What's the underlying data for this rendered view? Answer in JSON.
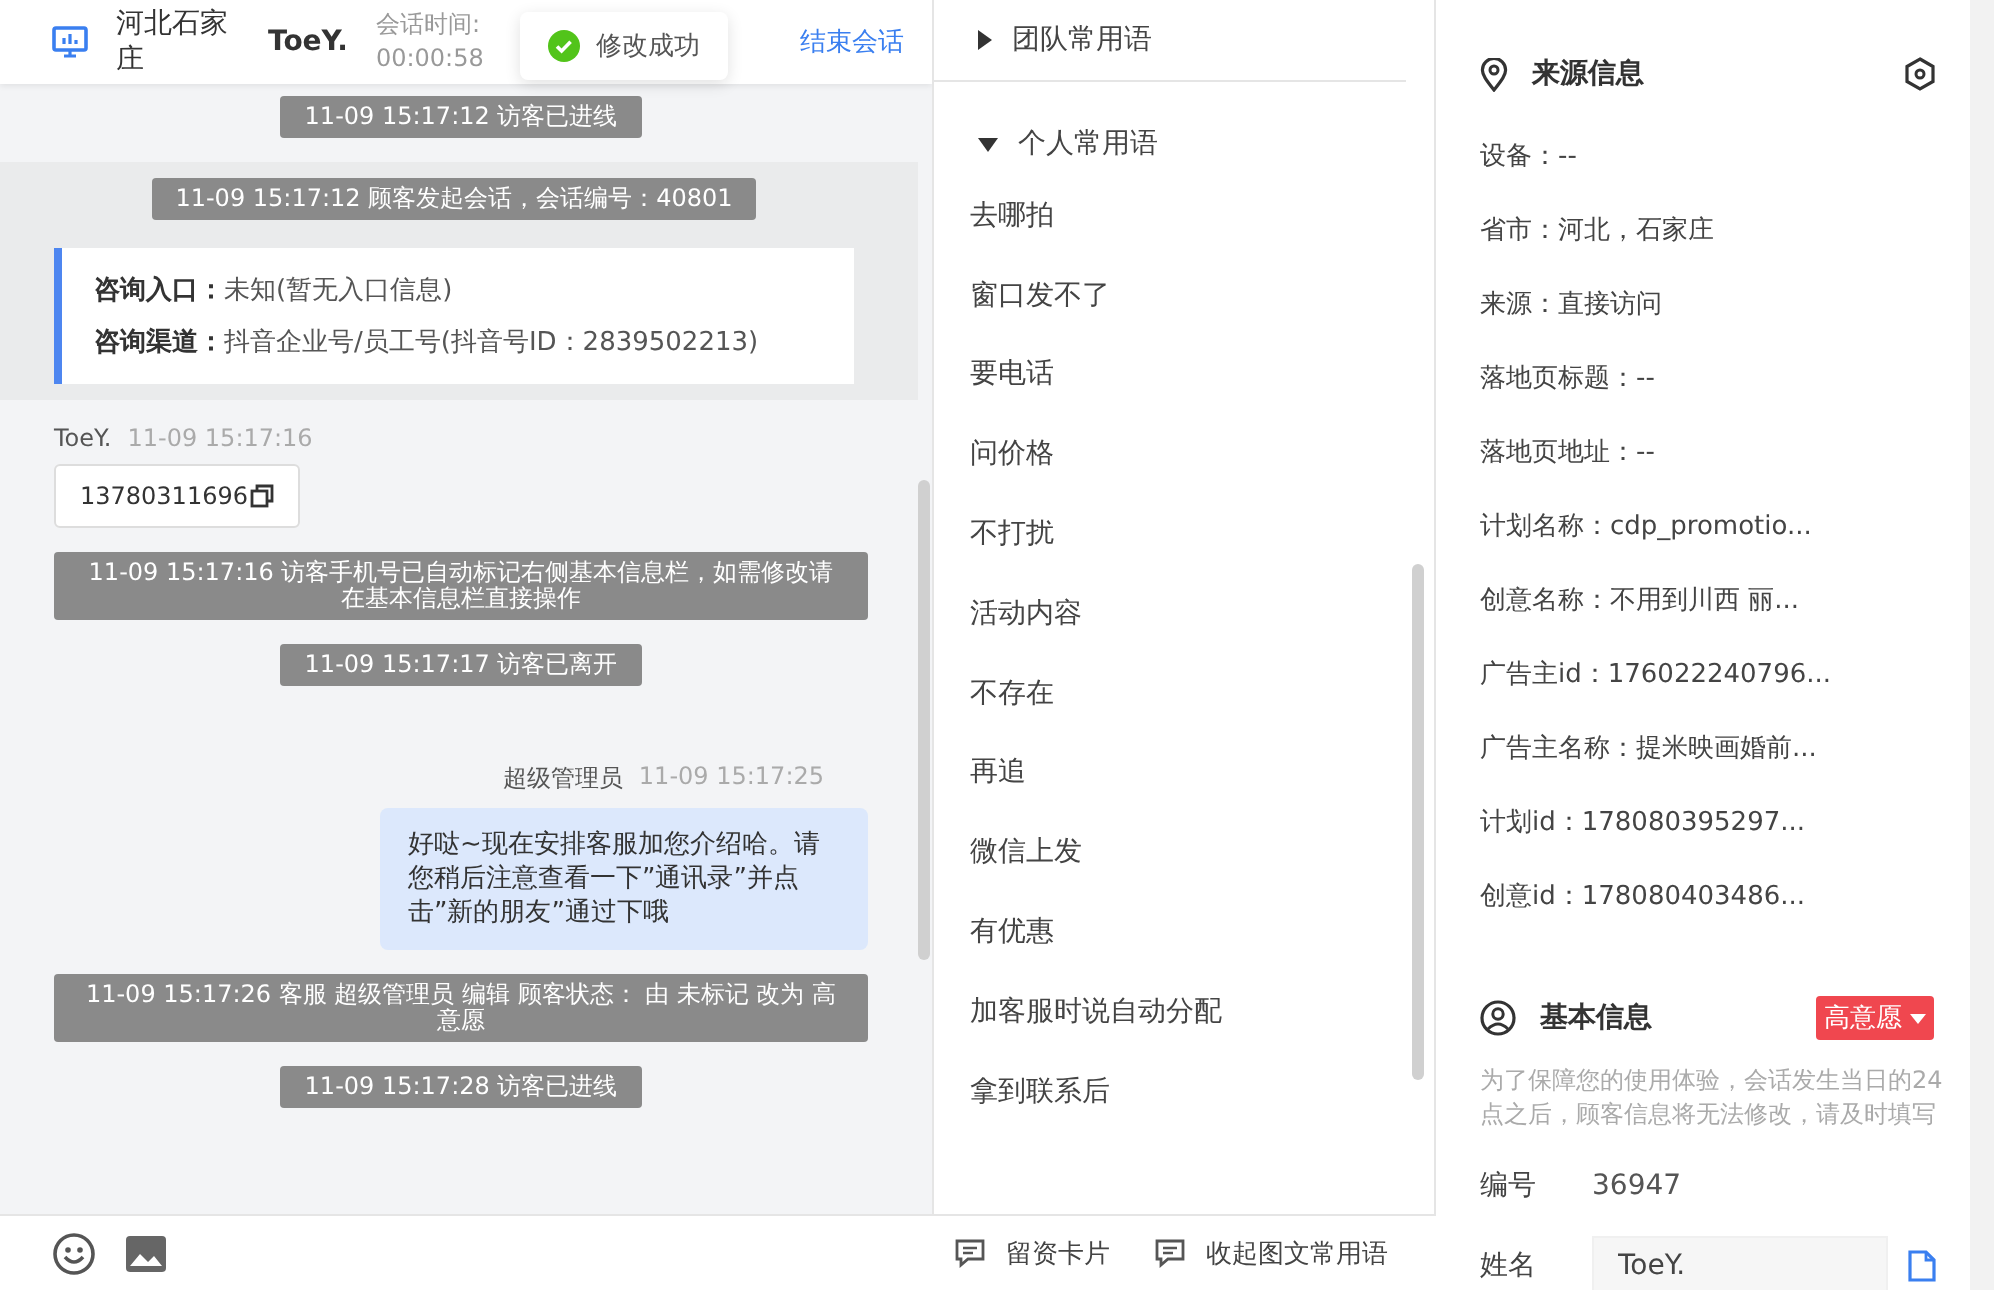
{
  "header": {
    "location": "河北石家庄",
    "visitor": "ToeY.",
    "timer_label": "会话时间:",
    "timer": "00:00:58",
    "end_button": "结束会话"
  },
  "toast": {
    "text": "修改成功"
  },
  "messages": [
    {
      "kind": "system",
      "text": "11-09 15:17:12 访客已进线"
    },
    {
      "kind": "session",
      "text": "11-09 15:17:12 顾客发起会话，会话编号：40801",
      "card": [
        {
          "label": "咨询入口：",
          "value": "未知(暂无入口信息)"
        },
        {
          "label": "咨询渠道：",
          "value": "抖音企业号/员工号(抖音号ID：2839502213)"
        }
      ]
    },
    {
      "kind": "visitor",
      "sender": "ToeY.",
      "time": "11-09 15:17:16",
      "text": "13780311696"
    },
    {
      "kind": "system",
      "text": "11-09 15:17:16 访客手机号已自动标记右侧基本信息栏，如需修改请在基本信息栏直接操作"
    },
    {
      "kind": "system",
      "text": "11-09 15:17:17 访客已离开"
    },
    {
      "kind": "agent",
      "sender": "超级管理员",
      "time": "11-09 15:17:25",
      "text": "好哒~现在安排客服加您介绍哈。请您稍后注意查看一下”通讯录”并点击”新的朋友”通过下哦"
    },
    {
      "kind": "system",
      "text": "11-09 15:17:26 客服 超级管理员 编辑 顾客状态： 由 未标记 改为 高意愿"
    },
    {
      "kind": "system",
      "text": "11-09 15:17:28 访客已进线"
    }
  ],
  "phrases": [
    {
      "title": "团队常用语",
      "expanded": false
    },
    {
      "title": "个人常用语",
      "expanded": true,
      "items": [
        "去哪拍",
        "窗口发不了",
        "要电话",
        "问价格",
        "不打扰",
        "活动内容",
        "不存在",
        "再追",
        "微信上发",
        "有优惠",
        "加客服时说自动分配",
        "拿到联系后"
      ]
    }
  ],
  "bottom_actions": [
    "留资卡片",
    "收起图文常用语"
  ],
  "source_info": {
    "title": "来源信息",
    "rows": [
      "设备：--",
      "省市：河北，石家庄",
      "来源：直接访问",
      "落地页标题：--",
      "落地页地址：--",
      "计划名称：cdp_promotio...",
      "创意名称：不用到川西 丽...",
      "广告主id：176022240796...",
      "广告主名称：提米映画婚前...",
      "计划id：178080395297...",
      "创意id：178080403486..."
    ]
  },
  "basic_info": {
    "title": "基本信息",
    "tag": {
      "label": "高意愿",
      "color": "#f0474f"
    },
    "notice": "为了保障您的使用体验，会话发生当日的24点之后，顾客信息将无法修改，请及时填写",
    "fields": [
      {
        "kind": "text",
        "label": "编号",
        "value": "36947"
      },
      {
        "kind": "input",
        "label": "姓名",
        "value": "ToeY."
      }
    ]
  }
}
